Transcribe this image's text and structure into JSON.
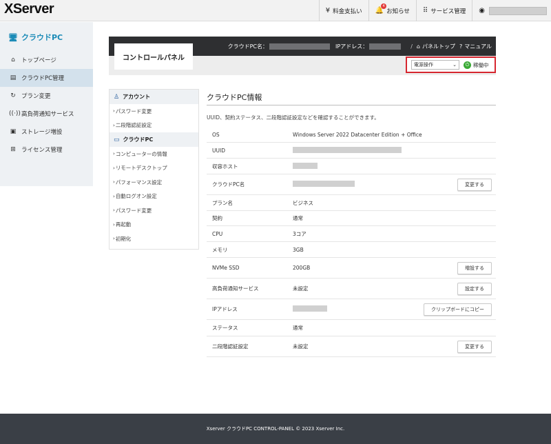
{
  "app": {
    "logo": "XServer"
  },
  "topnav": {
    "billing": "料金支払い",
    "news": "お知らせ",
    "news_badge": "4",
    "services": "サービス管理"
  },
  "sidebar": {
    "title": "クラウドPC",
    "items": [
      {
        "label": "トップページ",
        "icon": "home-icon"
      },
      {
        "label": "クラウドPC管理",
        "icon": "server-icon"
      },
      {
        "label": "プラン変更",
        "icon": "refresh-icon"
      },
      {
        "label": "高負荷通知サービス",
        "icon": "broadcast-icon"
      },
      {
        "label": "ストレージ増設",
        "icon": "storage-icon"
      },
      {
        "label": "ライセンス管理",
        "icon": "windows-icon"
      }
    ]
  },
  "control_panel": {
    "tab_label": "コントロールパネル",
    "pc_name_label": "クラウドPC名：",
    "ip_label": "IPアドレス：",
    "panel_top": "パネルトップ",
    "manual": "マニュアル",
    "power_select": "電源操作",
    "power_status": "稼働中"
  },
  "submenu": {
    "account_head": "アカウント",
    "account_items": [
      "パスワード変更",
      "二段階認証設定"
    ],
    "cloudpc_head": "クラウドPC",
    "cloudpc_items": [
      "コンピューターの情報",
      "リモートデスクトップ",
      "パフォーマンス設定",
      "自動ログオン設定",
      "パスワード変更",
      "再起動",
      "初期化"
    ]
  },
  "main": {
    "title": "クラウドPC情報",
    "description": "UUID、契約ステータス、二段階認証設定などを確認することができます。",
    "rows": [
      {
        "label": "OS",
        "value": "Windows Server 2022 Datacenter Edition + Office",
        "button": ""
      },
      {
        "label": "UUID",
        "value": "",
        "button": ""
      },
      {
        "label": "収容ホスト",
        "value": "",
        "button": ""
      },
      {
        "label": "クラウドPC名",
        "value": "",
        "button": "変更する"
      },
      {
        "label": "プラン名",
        "value": "ビジネス",
        "button": ""
      },
      {
        "label": "契約",
        "value": "通常",
        "button": ""
      },
      {
        "label": "CPU",
        "value": "3コア",
        "button": ""
      },
      {
        "label": "メモリ",
        "value": "3GB",
        "button": ""
      },
      {
        "label": "NVMe SSD",
        "value": "200GB",
        "button": "増設する"
      },
      {
        "label": "高負荷通知サービス",
        "value": "未設定",
        "button": "設定する"
      },
      {
        "label": "IPアドレス",
        "value": "",
        "button": "クリップボードにコピー"
      },
      {
        "label": "ステータス",
        "value": "通常",
        "button": ""
      },
      {
        "label": "二段階認証設定",
        "value": "未設定",
        "button": "変更する"
      }
    ]
  },
  "footer": {
    "text": "Xserver クラウドPC CONTROL-PANEL © 2023 Xserver Inc."
  },
  "colors": {
    "accent": "#1b8bb7",
    "highlight_border": "#d6262f",
    "status_green": "#3aaa35",
    "footer_bg": "#3a3f46"
  }
}
